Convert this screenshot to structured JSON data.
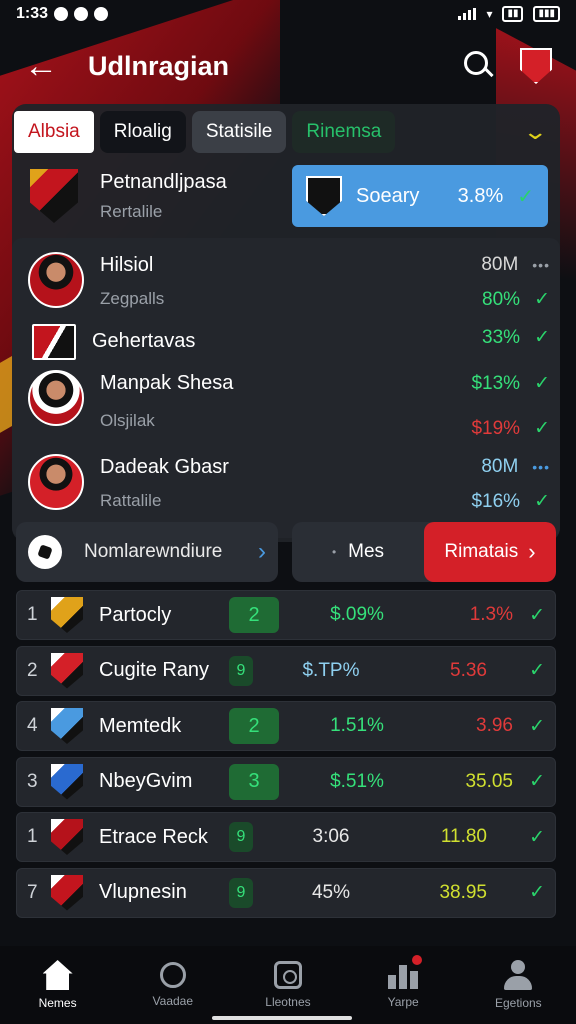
{
  "status_bar": {
    "time": "1:33",
    "battery_label": ""
  },
  "header": {
    "title": "Udlnragian"
  },
  "tabs": [
    {
      "label": "Albsia"
    },
    {
      "label": "Rloalig"
    },
    {
      "label": "Statisile"
    },
    {
      "label": "Rinemsa"
    }
  ],
  "featured": {
    "name": "Petnandljpasa",
    "sub": "Rertalile"
  },
  "summary": {
    "label": "Soeary",
    "value": "3.8%"
  },
  "players": [
    {
      "name": "Hilsiol",
      "sub": "Zegpalls",
      "val1": "80M",
      "val2": "80%"
    },
    {
      "name": "Gehertavas",
      "sub": "",
      "val1": "",
      "val2": "33%"
    },
    {
      "name": "Manpak Shesa",
      "sub": "Olsjilak",
      "val1": "$13%",
      "val2": "$19%"
    },
    {
      "name": "Dadeak Gbasr",
      "sub": "Rattalile",
      "val1": "80M",
      "val2": "$16%"
    }
  ],
  "filters": {
    "left_label": "Nomlarewndiure",
    "mid_label": "Mes",
    "right_label": "Rimatais"
  },
  "standings": [
    {
      "rank": "1",
      "team": "Partocly",
      "pts": "2",
      "v1": "$.09%",
      "v2": "1.3%",
      "v1_color": "#35e07a",
      "v2_color": "#e03a3a",
      "crest": "#e0a21a"
    },
    {
      "rank": "2",
      "team": "Cugite Rany",
      "pts": "9",
      "v1": "$.TP%",
      "v2": "5.36",
      "v1_color": "#8fd0f0",
      "v2_color": "#e03a3a",
      "crest": "#d42028"
    },
    {
      "rank": "4",
      "team": "Memtedk",
      "pts": "2",
      "v1": "1.51%",
      "v2": "3.96",
      "v1_color": "#35e07a",
      "v2_color": "#e03a3a",
      "crest": "#4a9ae0"
    },
    {
      "rank": "3",
      "team": "NbeyGvim",
      "pts": "3",
      "v1": "$.51%",
      "v2": "35.05",
      "v1_color": "#35e07a",
      "v2_color": "#d0e030",
      "crest": "#2a6ad0"
    },
    {
      "rank": "1",
      "team": "Etrace Reck",
      "pts": "9",
      "v1": "3:06",
      "v2": "11.80",
      "v1_color": "#e8e8e8",
      "v2_color": "#d0e030",
      "crest": "#b5121b"
    },
    {
      "rank": "7",
      "team": "Vlupnesin",
      "pts": "9",
      "v1": "45%",
      "v2": "38.95",
      "v1_color": "#e8e8e8",
      "v2_color": "#d0e030",
      "crest": "#c3151e"
    }
  ],
  "bottom_nav": [
    {
      "label": "Nemes"
    },
    {
      "label": "Vaadae"
    },
    {
      "label": "Lleotnes"
    },
    {
      "label": "Yarpe"
    },
    {
      "label": "Egetions"
    }
  ]
}
